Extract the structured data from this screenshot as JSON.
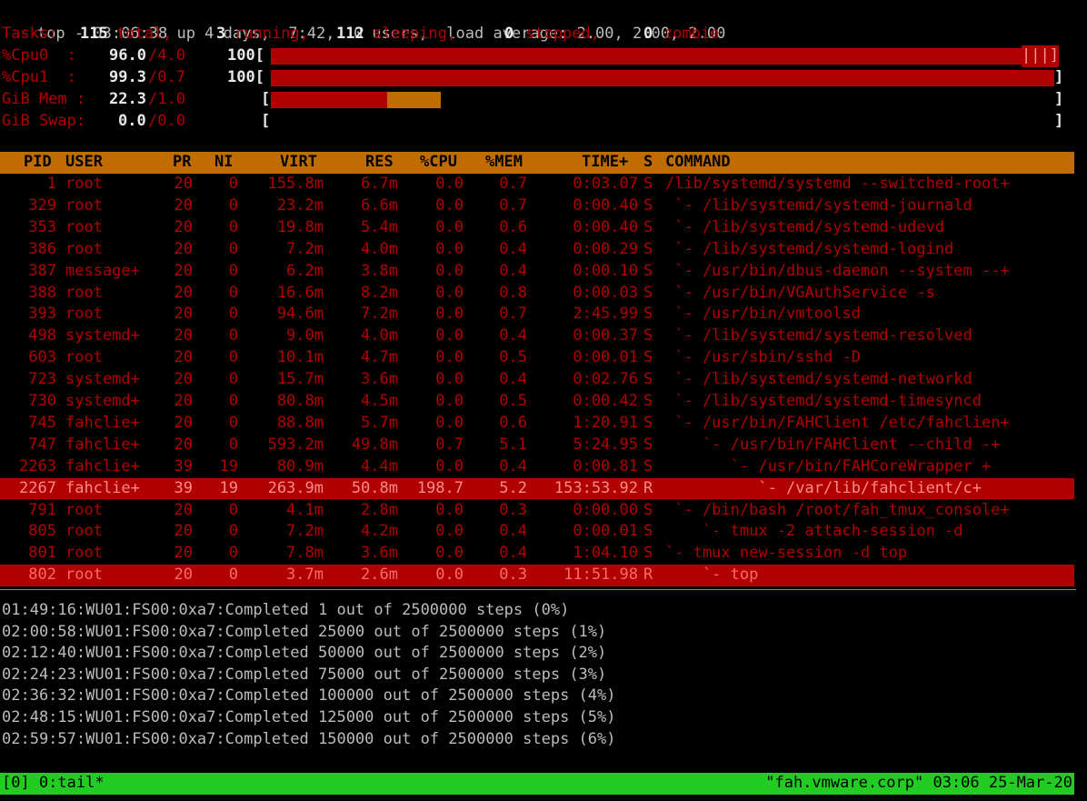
{
  "top_summary": {
    "line1": "top - 03:06:38 up 4 days,  7:42,  0 users,  load average: 2.00, 2.00, 2.00",
    "tasks_label": "Tasks:",
    "tasks_total": "115",
    "tasks_total_label": "total,",
    "tasks_running": "3",
    "tasks_running_label": "running,",
    "tasks_sleeping": "112",
    "tasks_sleeping_label": "sleeping,",
    "tasks_stopped": "0",
    "tasks_stopped_label": "stopped,",
    "tasks_zombie": "0",
    "tasks_zombie_label": "zombie",
    "cpu0_label": "%Cpu0  :",
    "cpu0_value": "96.0",
    "cpu0_sys": "/4.0",
    "cpu0_pct_label": "100[",
    "cpu0_fill": 1.0,
    "cpu0_tail": "|||]",
    "cpu1_label": "%Cpu1  :",
    "cpu1_value": "99.3",
    "cpu1_sys": "/0.7",
    "cpu1_pct_label": "100[",
    "cpu1_fill": 1.0,
    "cpu1_tail": "]",
    "mem_label": "GiB Mem :",
    "mem_value": "22.3",
    "mem_sub": "/1.0",
    "mem_open": "[",
    "mem_close": "]",
    "mem_used_fraction": 0.148,
    "mem_buff_fraction": 0.069,
    "swap_label": "GiB Swap:",
    "swap_value": "0.0",
    "swap_sub": "/0.0",
    "swap_open": "[",
    "swap_close": "]"
  },
  "columns": [
    "PID",
    "USER",
    "PR",
    "NI",
    "VIRT",
    "RES",
    "%CPU",
    "%MEM",
    "TIME+",
    "S",
    "COMMAND"
  ],
  "processes": [
    {
      "pid": "1",
      "user": "root",
      "pr": "20",
      "ni": "0",
      "virt": "155.8m",
      "res": "6.7m",
      "cpu": "0.0",
      "mem": "0.7",
      "time": "0:03.07",
      "s": "S",
      "cmd": "/lib/systemd/systemd --switched-root+"
    },
    {
      "pid": "329",
      "user": "root",
      "pr": "20",
      "ni": "0",
      "virt": "23.2m",
      "res": "6.6m",
      "cpu": "0.0",
      "mem": "0.7",
      "time": "0:00.40",
      "s": "S",
      "cmd": " `- /lib/systemd/systemd-journald"
    },
    {
      "pid": "353",
      "user": "root",
      "pr": "20",
      "ni": "0",
      "virt": "19.8m",
      "res": "5.4m",
      "cpu": "0.0",
      "mem": "0.6",
      "time": "0:00.40",
      "s": "S",
      "cmd": " `- /lib/systemd/systemd-udevd"
    },
    {
      "pid": "386",
      "user": "root",
      "pr": "20",
      "ni": "0",
      "virt": "7.2m",
      "res": "4.0m",
      "cpu": "0.0",
      "mem": "0.4",
      "time": "0:00.29",
      "s": "S",
      "cmd": " `- /lib/systemd/systemd-logind"
    },
    {
      "pid": "387",
      "user": "message+",
      "pr": "20",
      "ni": "0",
      "virt": "6.2m",
      "res": "3.8m",
      "cpu": "0.0",
      "mem": "0.4",
      "time": "0:00.10",
      "s": "S",
      "cmd": " `- /usr/bin/dbus-daemon --system --+"
    },
    {
      "pid": "388",
      "user": "root",
      "pr": "20",
      "ni": "0",
      "virt": "16.6m",
      "res": "8.2m",
      "cpu": "0.0",
      "mem": "0.8",
      "time": "0:00.03",
      "s": "S",
      "cmd": " `- /usr/bin/VGAuthService -s"
    },
    {
      "pid": "393",
      "user": "root",
      "pr": "20",
      "ni": "0",
      "virt": "94.6m",
      "res": "7.2m",
      "cpu": "0.0",
      "mem": "0.7",
      "time": "2:45.99",
      "s": "S",
      "cmd": " `- /usr/bin/vmtoolsd"
    },
    {
      "pid": "498",
      "user": "systemd+",
      "pr": "20",
      "ni": "0",
      "virt": "9.0m",
      "res": "4.0m",
      "cpu": "0.0",
      "mem": "0.4",
      "time": "0:00.37",
      "s": "S",
      "cmd": " `- /lib/systemd/systemd-resolved"
    },
    {
      "pid": "603",
      "user": "root",
      "pr": "20",
      "ni": "0",
      "virt": "10.1m",
      "res": "4.7m",
      "cpu": "0.0",
      "mem": "0.5",
      "time": "0:00.01",
      "s": "S",
      "cmd": " `- /usr/sbin/sshd -D"
    },
    {
      "pid": "723",
      "user": "systemd+",
      "pr": "20",
      "ni": "0",
      "virt": "15.7m",
      "res": "3.6m",
      "cpu": "0.0",
      "mem": "0.4",
      "time": "0:02.76",
      "s": "S",
      "cmd": " `- /lib/systemd/systemd-networkd"
    },
    {
      "pid": "730",
      "user": "systemd+",
      "pr": "20",
      "ni": "0",
      "virt": "80.8m",
      "res": "4.5m",
      "cpu": "0.0",
      "mem": "0.5",
      "time": "0:00.42",
      "s": "S",
      "cmd": " `- /lib/systemd/systemd-timesyncd"
    },
    {
      "pid": "745",
      "user": "fahclie+",
      "pr": "20",
      "ni": "0",
      "virt": "88.8m",
      "res": "5.7m",
      "cpu": "0.0",
      "mem": "0.6",
      "time": "1:20.91",
      "s": "S",
      "cmd": " `- /usr/bin/FAHClient /etc/fahclien+"
    },
    {
      "pid": "747",
      "user": "fahclie+",
      "pr": "20",
      "ni": "0",
      "virt": "593.2m",
      "res": "49.8m",
      "cpu": "0.7",
      "mem": "5.1",
      "time": "5:24.95",
      "s": "S",
      "cmd": "    `- /usr/bin/FAHClient --child -+"
    },
    {
      "pid": "2263",
      "user": "fahclie+",
      "pr": "39",
      "ni": "19",
      "virt": "80.9m",
      "res": "4.4m",
      "cpu": "0.0",
      "mem": "0.4",
      "time": "0:00.81",
      "s": "S",
      "cmd": "       `- /usr/bin/FAHCoreWrapper +"
    },
    {
      "pid": "2267",
      "user": "fahclie+",
      "pr": "39",
      "ni": "19",
      "virt": "263.9m",
      "res": "50.8m",
      "cpu": "198.7",
      "mem": "5.2",
      "time": "153:53.92",
      "s": "R",
      "cmd": "          `- /var/lib/fahclient/c+",
      "highlight": "sel"
    },
    {
      "pid": "791",
      "user": "root",
      "pr": "20",
      "ni": "0",
      "virt": "4.1m",
      "res": "2.8m",
      "cpu": "0.0",
      "mem": "0.3",
      "time": "0:00.00",
      "s": "S",
      "cmd": " `- /bin/bash /root/fah_tmux_console+"
    },
    {
      "pid": "805",
      "user": "root",
      "pr": "20",
      "ni": "0",
      "virt": "7.2m",
      "res": "4.2m",
      "cpu": "0.0",
      "mem": "0.4",
      "time": "0:00.01",
      "s": "S",
      "cmd": "    `- tmux -2 attach-session -d"
    },
    {
      "pid": "801",
      "user": "root",
      "pr": "20",
      "ni": "0",
      "virt": "7.8m",
      "res": "3.6m",
      "cpu": "0.0",
      "mem": "0.4",
      "time": "1:04.10",
      "s": "S",
      "cmd": "`- tmux new-session -d top"
    },
    {
      "pid": "802",
      "user": "root",
      "pr": "20",
      "ni": "0",
      "virt": "3.7m",
      "res": "2.6m",
      "cpu": "0.0",
      "mem": "0.3",
      "time": "11:51.98",
      "s": "R",
      "cmd": "    `- top",
      "highlight": "cur"
    }
  ],
  "log_lines": [
    "01:49:16:WU01:FS00:0xa7:Completed 1 out of 2500000 steps (0%)",
    "02:00:58:WU01:FS00:0xa7:Completed 25000 out of 2500000 steps (1%)",
    "02:12:40:WU01:FS00:0xa7:Completed 50000 out of 2500000 steps (2%)",
    "02:24:23:WU01:FS00:0xa7:Completed 75000 out of 2500000 steps (3%)",
    "02:36:32:WU01:FS00:0xa7:Completed 100000 out of 2500000 steps (4%)",
    "02:48:15:WU01:FS00:0xa7:Completed 125000 out of 2500000 steps (5%)",
    "02:59:57:WU01:FS00:0xa7:Completed 150000 out of 2500000 steps (6%)"
  ],
  "tmux_status": {
    "left": "[0] 0:tail*",
    "right": "\"fah.vmware.corp\" 03:06 25-Mar-20"
  },
  "colors": {
    "red": "#b00000",
    "orange": "#c06c00",
    "green": "#22cc22"
  }
}
